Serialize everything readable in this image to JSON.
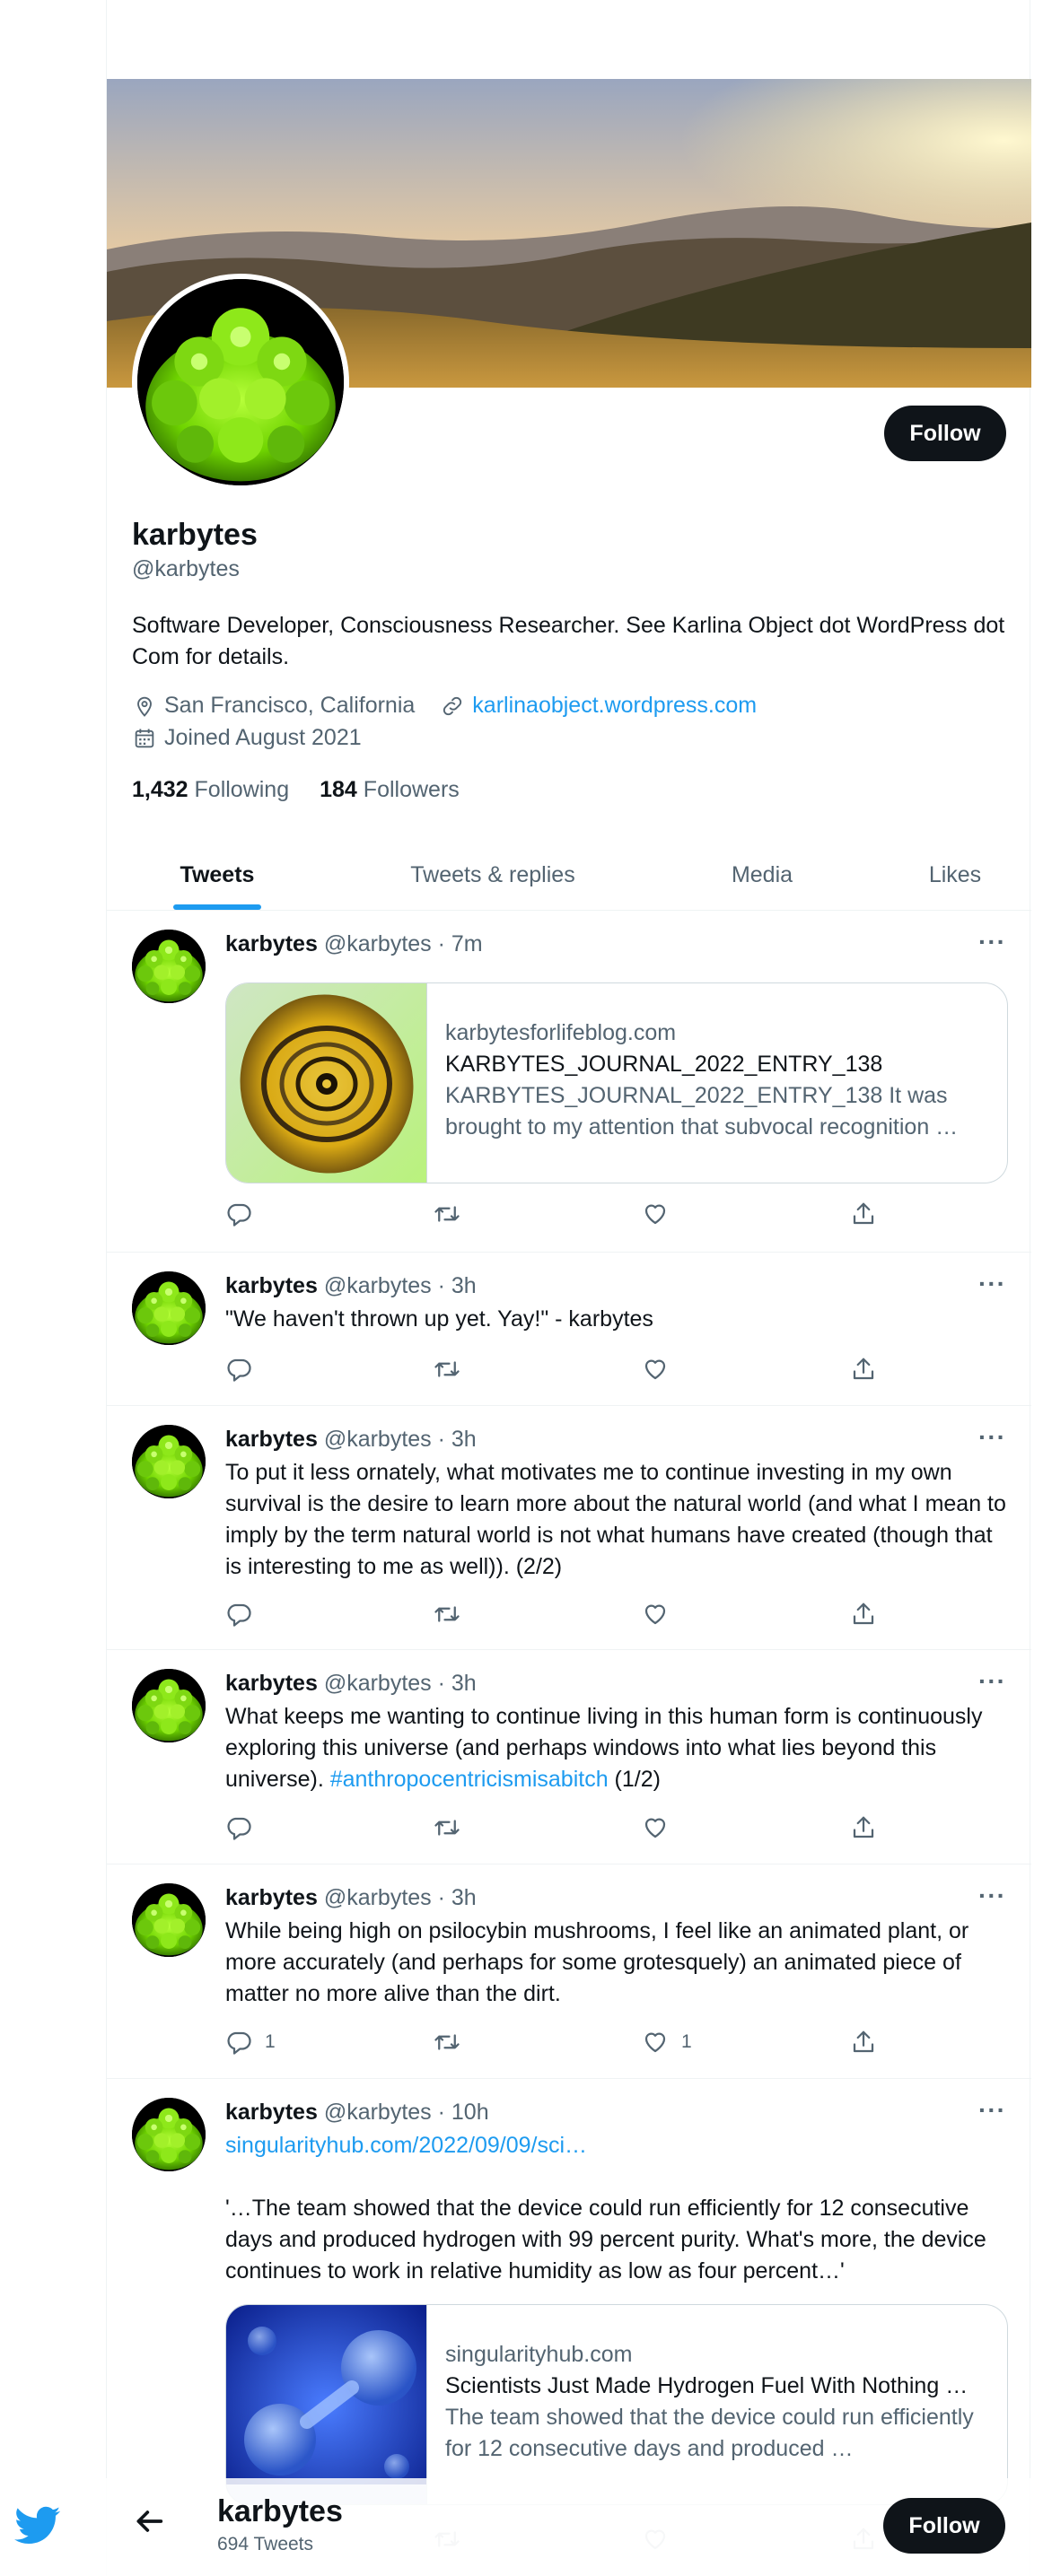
{
  "profile": {
    "name": "karbytes",
    "handle": "@karbytes",
    "bio": "Software Developer, Consciousness Researcher. See Karlina Object dot WordPress dot Com for details.",
    "location": "San Francisco, California",
    "website": "karlinaobject.wordpress.com",
    "joined": "Joined August 2021",
    "following_count": "1,432",
    "following_label": "Following",
    "followers_count": "184",
    "followers_label": "Followers",
    "follow_label": "Follow"
  },
  "tabs": [
    {
      "label": "Tweets",
      "active": true
    },
    {
      "label": "Tweets & replies",
      "active": false
    },
    {
      "label": "Media",
      "active": false
    },
    {
      "label": "Likes",
      "active": false
    }
  ],
  "tweets": [
    {
      "name": "karbytes",
      "meta": "@karbytes · 7m",
      "card": {
        "domain": "karbytesforlifeblog.com",
        "title": "KARBYTES_JOURNAL_2022_ENTRY_138",
        "desc": "KARBYTES_JOURNAL_2022_ENTRY_138 It was brought to my attention that subvocal recognition …"
      },
      "replies": "",
      "likes": ""
    },
    {
      "name": "karbytes",
      "meta": "@karbytes · 3h",
      "text": "\"We haven't thrown up yet. Yay!\" - karbytes",
      "replies": "",
      "likes": ""
    },
    {
      "name": "karbytes",
      "meta": "@karbytes · 3h",
      "text": "To put it less ornately, what motivates me to continue investing in my own survival is the desire to learn more about the natural world (and what I mean to imply by the term natural world is not what humans have created (though that is interesting to me as well)). (2/2)",
      "replies": "",
      "likes": ""
    },
    {
      "name": "karbytes",
      "meta": "@karbytes · 3h",
      "text": "What keeps me wanting to continue living in this human form is continuously exploring this universe (and perhaps windows into what lies beyond this universe).",
      "hashtag": "#anthropocentricismisabitch",
      "text_after": " (1/2)",
      "replies": "",
      "likes": ""
    },
    {
      "name": "karbytes",
      "meta": "@karbytes · 3h",
      "text": "While being high on psilocybin mushrooms, I feel like an animated plant, or more accurately (and perhaps for some grotesquely) an animated piece of matter no more alive than the dirt.",
      "replies": "1",
      "likes": "1"
    },
    {
      "name": "karbytes",
      "meta": "@karbytes · 10h",
      "link": "singularityhub.com/2022/09/09/sci…",
      "text": "'…The team showed that the device could run efficiently for 12 consecutive days and produced hydrogen with 99 percent purity. What's more, the device continues to work in relative humidity as low as four percent…'",
      "card": {
        "domain": "singularityhub.com",
        "title": "Scientists Just Made Hydrogen Fuel With Nothing …",
        "desc": "The team showed that the device could run efficiently for 12 consecutive days and produced …"
      },
      "replies": "",
      "likes": ""
    }
  ],
  "more_icon": "···",
  "bottom_bar": {
    "name": "karbytes",
    "tweet_count": "694 Tweets",
    "follow_label": "Follow"
  },
  "colors": {
    "accent": "#1d9bf0",
    "text": "#0f1419",
    "secondary": "#536471",
    "border": "#eff3f4"
  },
  "icons": [
    "twitter-bird-icon",
    "back-arrow-icon",
    "location-pin-icon",
    "link-icon",
    "calendar-icon",
    "reply-icon",
    "retweet-icon",
    "like-icon",
    "share-icon",
    "more-icon"
  ]
}
